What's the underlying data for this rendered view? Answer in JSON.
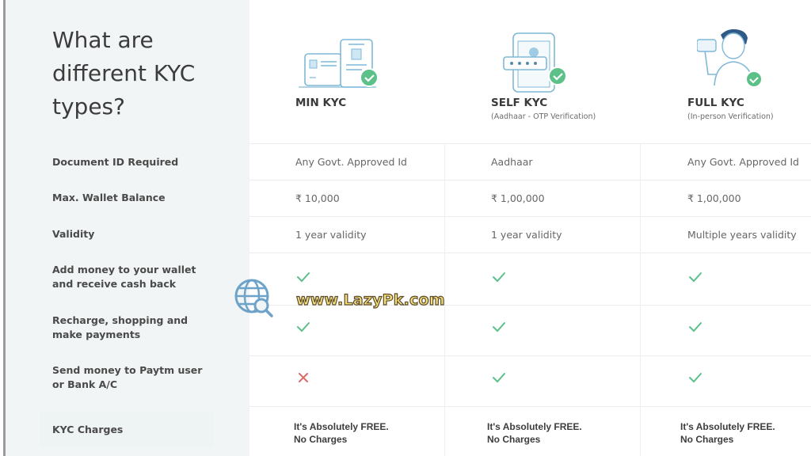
{
  "title": "What are different KYC types?",
  "plans": [
    {
      "name": "MIN KYC",
      "subtitle": "",
      "illustration": "id-cards-icon"
    },
    {
      "name": "SELF KYC",
      "subtitle": "(Aadhaar - OTP Verification)",
      "illustration": "phone-otp-icon"
    },
    {
      "name": "FULL KYC",
      "subtitle": "(In-person Verification)",
      "illustration": "person-with-id-icon"
    }
  ],
  "rows": [
    {
      "label": "Document ID Required",
      "values": [
        "Any Govt. Approved Id",
        "Aadhaar",
        "Any Govt. Approved Id"
      ]
    },
    {
      "label": "Max. Wallet Balance",
      "values": [
        "₹ 10,000",
        "₹ 1,00,000",
        "₹ 1,00,000"
      ]
    },
    {
      "label": "Validity",
      "values": [
        "1 year validity",
        "1 year validity",
        "Multiple years validity"
      ]
    },
    {
      "label": "Add money to your wallet and receive cash back",
      "values": [
        "check",
        "check",
        "check"
      ]
    },
    {
      "label": "Recharge, shopping and make payments",
      "values": [
        "check",
        "check",
        "check"
      ]
    },
    {
      "label": "Send money to Paytm user or Bank A/C",
      "values": [
        "cross",
        "check",
        "check"
      ]
    }
  ],
  "charges": {
    "label": "KYC Charges",
    "values": [
      {
        "line1": "It's Absolutely FREE.",
        "line2": "No Charges"
      },
      {
        "line1": "It's Absolutely FREE.",
        "line2": "No Charges"
      },
      {
        "line1": "It's Absolutely FREE.",
        "line2": "No Charges"
      }
    ]
  },
  "watermark": {
    "text": "www.LazyPk.com",
    "icon": "globe-search-icon"
  },
  "colors": {
    "check": "#5cc189",
    "cross": "#e06666",
    "illustration": "#7fb8d8",
    "badge": "#5cc189"
  }
}
